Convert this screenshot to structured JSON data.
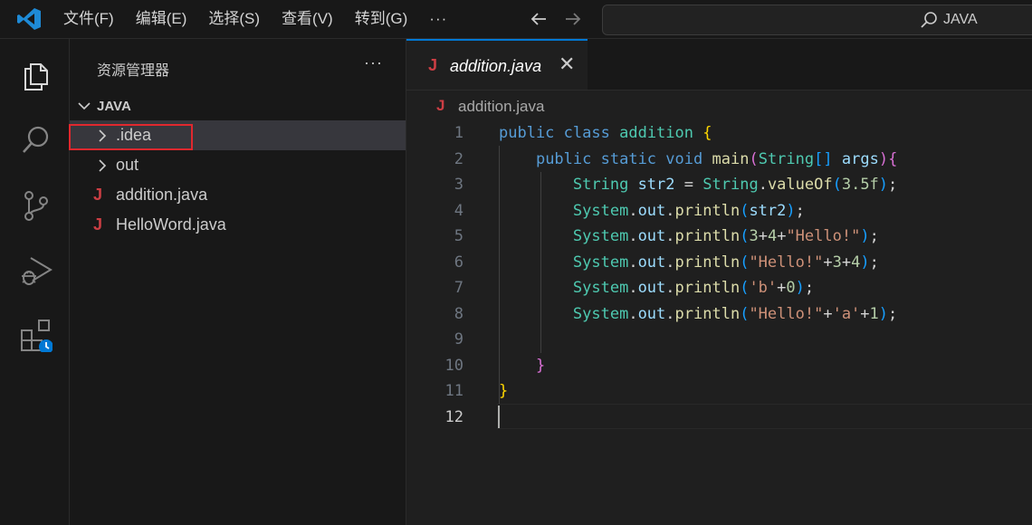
{
  "menu": {
    "file": "文件(F)",
    "edit": "编辑(E)",
    "selection": "选择(S)",
    "view": "查看(V)",
    "goto": "转到(G)",
    "more": "···"
  },
  "search": {
    "text": "JAVA"
  },
  "sidebar": {
    "title": "资源管理器",
    "more": "···",
    "section": "JAVA",
    "items": [
      {
        "label": ".idea",
        "type": "folder",
        "icon": "chevron-right-icon"
      },
      {
        "label": "out",
        "type": "folder",
        "icon": "chevron-right-icon"
      },
      {
        "label": "addition.java",
        "type": "file",
        "icon": "java-icon",
        "icon_glyph": "J"
      },
      {
        "label": "HelloWord.java",
        "type": "file",
        "icon": "java-icon",
        "icon_glyph": "J"
      }
    ]
  },
  "editor": {
    "tab_label": "addition.java",
    "tab_close": "✕",
    "breadcrumb": "addition.java",
    "line_numbers": [
      "1",
      "2",
      "3",
      "4",
      "5",
      "6",
      "7",
      "8",
      "9",
      "10",
      "11",
      "12"
    ],
    "active_line": "12",
    "lines": [
      "public class addition {",
      "    public static void main(String[] args){",
      "        String str2 = String.valueOf(3.5f);",
      "        System.out.println(str2);",
      "        System.out.println(3+4+\"Hello!\");",
      "        System.out.println(\"Hello!\"+3+4);",
      "        System.out.println('b'+0);",
      "        System.out.println(\"Hello!\"+'a'+1);",
      "",
      "    }",
      "}",
      ""
    ]
  },
  "colors": {
    "accent": "#0078d4",
    "java_icon": "#cc3e44",
    "highlight_box": "#e0282e",
    "keyword": "#569cd6",
    "type": "#4ec9b0",
    "function": "#dcdcaa",
    "string": "#ce9178",
    "number": "#b5cea8"
  }
}
